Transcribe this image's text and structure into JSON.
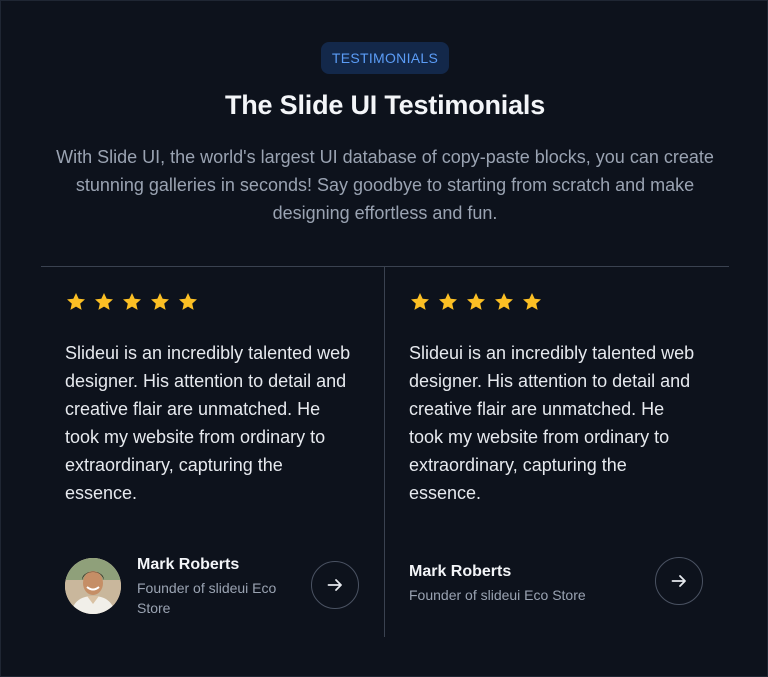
{
  "badge": "TESTIMONIALS",
  "title": "The Slide UI Testimonials",
  "subtitle": "With Slide UI, the world's largest UI database of copy-paste blocks, you can create stunning galleries in seconds! Say goodbye to starting from scratch and make designing effortless and fun.",
  "colors": {
    "background": "#0d121c",
    "badge_bg": "#13284a",
    "badge_text": "#5b9cf6",
    "star": "#fbbf24",
    "divider": "#3a4250"
  },
  "testimonials": [
    {
      "rating": 5,
      "quote": "Slideui is an incredibly talented web designer. His attention to detail and creative flair are unmatched. He took my website from ordinary to extraordinary, capturing the essence.",
      "name": "Mark Roberts",
      "role": "Founder of slideui Eco Store",
      "has_avatar": true,
      "icon": "arrow-right-icon"
    },
    {
      "rating": 5,
      "quote": "Slideui is an incredibly talented web designer. His attention to detail and creative flair are unmatched. He took my website from ordinary to extraordinary, capturing the essence.",
      "name": "Mark Roberts",
      "role": "Founder of slideui Eco Store",
      "has_avatar": false,
      "icon": "arrow-right-icon"
    }
  ]
}
